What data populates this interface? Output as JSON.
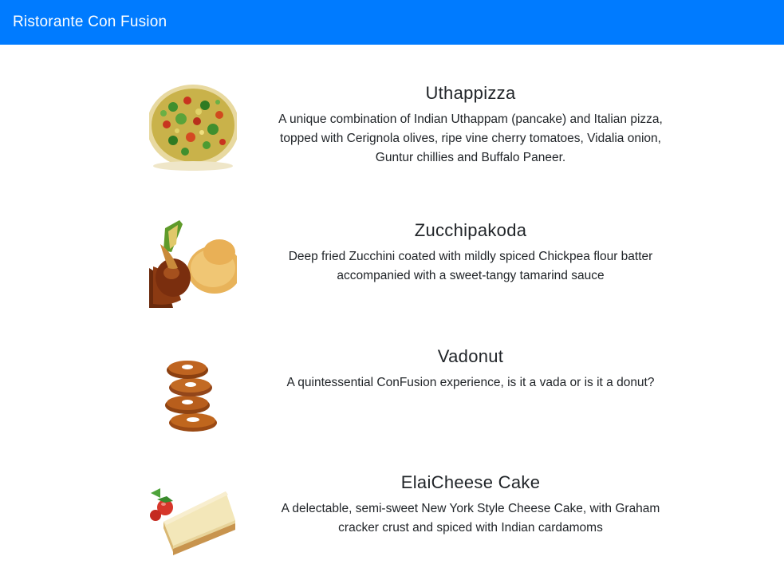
{
  "navbar": {
    "brand": "Ristorante Con Fusion",
    "color": "#007bff"
  },
  "dishes": [
    {
      "name": "Uthappizza",
      "description": "A unique combination of Indian Uthappam (pancake) and Italian pizza, topped with Cerignola olives, ripe vine cherry tomatoes, Vidalia onion, Guntur chillies and Buffalo Paneer.",
      "image_icon": "uthappizza-image"
    },
    {
      "name": "Zucchipakoda",
      "description": "Deep fried Zucchini coated with mildly spiced Chickpea flour batter accompanied with a sweet-tangy tamarind sauce",
      "image_icon": "zucchipakoda-image"
    },
    {
      "name": "Vadonut",
      "description": "A quintessential ConFusion experience, is it a vada or is it a donut?",
      "image_icon": "vadonut-image"
    },
    {
      "name": "ElaiCheese Cake",
      "description": "A delectable, semi-sweet New York Style Cheese Cake, with Graham cracker crust and spiced with Indian cardamoms",
      "image_icon": "cheesecake-image"
    }
  ]
}
